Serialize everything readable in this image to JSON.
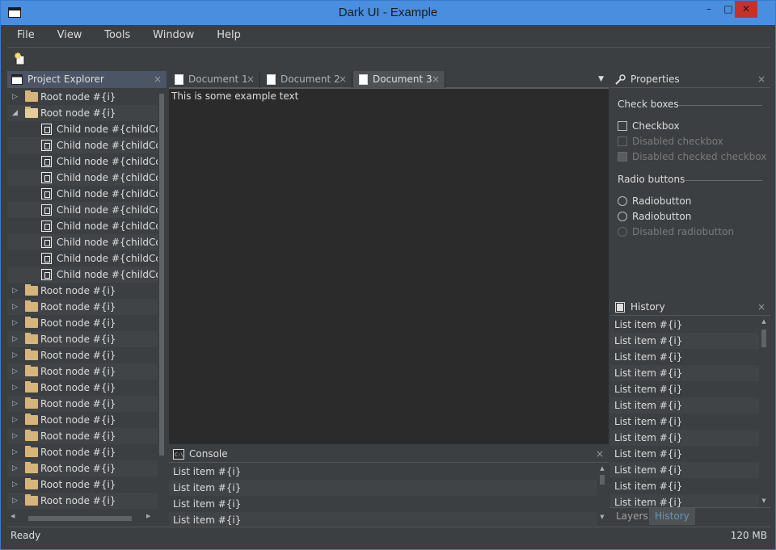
{
  "window": {
    "title": "Dark UI - Example",
    "minimize": "–",
    "maximize": "□",
    "close": "✕"
  },
  "menu": [
    "File",
    "View",
    "Tools",
    "Window",
    "Help"
  ],
  "toolbar": {
    "tool_icon": "new-file-icon"
  },
  "project_explorer": {
    "title": "Project Explorer",
    "close": "×",
    "nodes": [
      {
        "label": "Root node #{i}",
        "type": "root",
        "expanded": false
      },
      {
        "label": "Root node #{i}",
        "type": "root",
        "expanded": true
      },
      {
        "label": "Child node #{childCount}",
        "type": "child"
      },
      {
        "label": "Child node #{childCount}",
        "type": "child"
      },
      {
        "label": "Child node #{childCount}",
        "type": "child"
      },
      {
        "label": "Child node #{childCount}",
        "type": "child"
      },
      {
        "label": "Child node #{childCount}",
        "type": "child"
      },
      {
        "label": "Child node #{childCount}",
        "type": "child"
      },
      {
        "label": "Child node #{childCount}",
        "type": "child"
      },
      {
        "label": "Child node #{childCount}",
        "type": "child"
      },
      {
        "label": "Child node #{childCount}",
        "type": "child"
      },
      {
        "label": "Child node #{childCount}",
        "type": "child"
      },
      {
        "label": "Root node #{i}",
        "type": "root",
        "expanded": false
      },
      {
        "label": "Root node #{i}",
        "type": "root",
        "expanded": false
      },
      {
        "label": "Root node #{i}",
        "type": "root",
        "expanded": false
      },
      {
        "label": "Root node #{i}",
        "type": "root",
        "expanded": false
      },
      {
        "label": "Root node #{i}",
        "type": "root",
        "expanded": false
      },
      {
        "label": "Root node #{i}",
        "type": "root",
        "expanded": false
      },
      {
        "label": "Root node #{i}",
        "type": "root",
        "expanded": false
      },
      {
        "label": "Root node #{i}",
        "type": "root",
        "expanded": false
      },
      {
        "label": "Root node #{i}",
        "type": "root",
        "expanded": false
      },
      {
        "label": "Root node #{i}",
        "type": "root",
        "expanded": false
      },
      {
        "label": "Root node #{i}",
        "type": "root",
        "expanded": false
      },
      {
        "label": "Root node #{i}",
        "type": "root",
        "expanded": false
      },
      {
        "label": "Root node #{i}",
        "type": "root",
        "expanded": false
      },
      {
        "label": "Root node #{i}",
        "type": "root",
        "expanded": false
      }
    ]
  },
  "documents": {
    "tabs": [
      {
        "label": "Document 1",
        "active": false
      },
      {
        "label": "Document 2",
        "active": false
      },
      {
        "label": "Document 3",
        "active": true
      }
    ],
    "tab_close": "×",
    "dropdown": "▼",
    "text": "This is some example text"
  },
  "console": {
    "title": "Console",
    "close": "×",
    "items": [
      "List item #{i}",
      "List item #{i}",
      "List item #{i}",
      "List item #{i}"
    ]
  },
  "properties": {
    "title": "Properties",
    "close": "×",
    "checkbox_section": "Check boxes",
    "checkboxes": [
      {
        "label": "Checkbox",
        "disabled": false,
        "checked": false
      },
      {
        "label": "Disabled checkbox",
        "disabled": true,
        "checked": false
      },
      {
        "label": "Disabled checked checkbox",
        "disabled": true,
        "checked": true
      }
    ],
    "radio_section": "Radio buttons",
    "radios": [
      {
        "label": "Radiobutton",
        "disabled": false
      },
      {
        "label": "Radiobutton",
        "disabled": false
      },
      {
        "label": "Disabled radiobutton",
        "disabled": true
      }
    ]
  },
  "history": {
    "title": "History",
    "close": "×",
    "items": [
      "List item #{i}",
      "List item #{i}",
      "List item #{i}",
      "List item #{i}",
      "List item #{i}",
      "List item #{i}",
      "List item #{i}",
      "List item #{i}",
      "List item #{i}",
      "List item #{i}",
      "List item #{i}",
      "List item #{i}"
    ],
    "tabs": [
      {
        "label": "Layers",
        "active": false
      },
      {
        "label": "History",
        "active": true
      }
    ]
  },
  "status": {
    "text": "Ready",
    "memory": "120 MB"
  },
  "colors": {
    "accent": "#4a8ee0",
    "background": "#3c3f41",
    "editor": "#2b2b2b",
    "close_red": "#c7312a",
    "active_tab_text": "#6897bb"
  }
}
